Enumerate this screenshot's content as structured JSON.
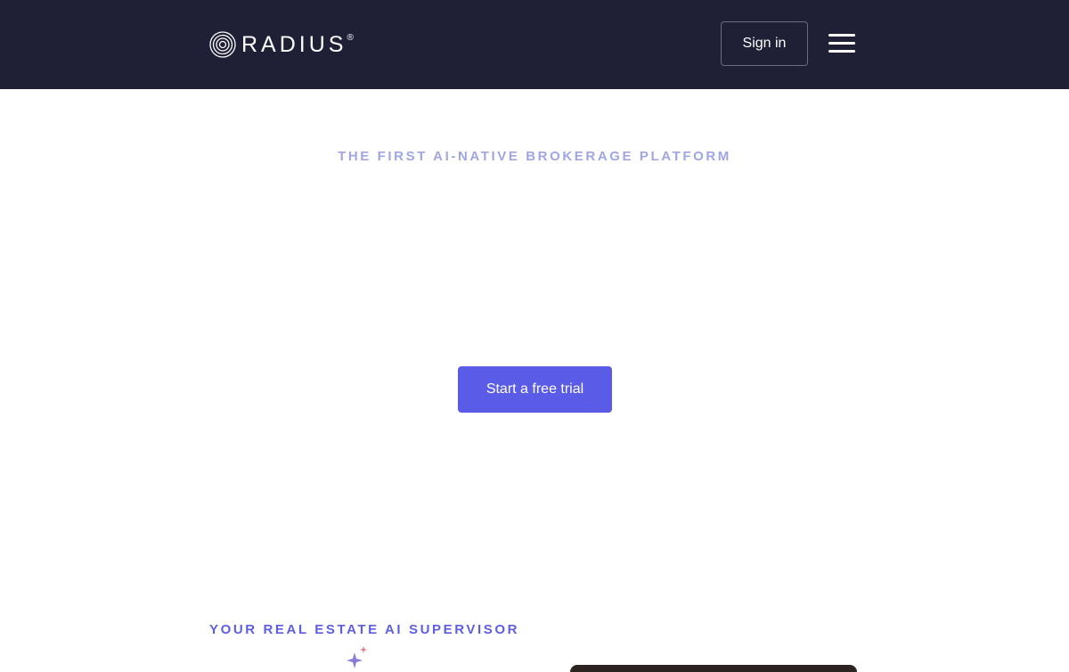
{
  "nav": {
    "logo_text": "RADIUS",
    "logo_reg": "®",
    "signin_label": "Sign in",
    "menu_icon": "hamburger-icon"
  },
  "hero": {
    "eyebrow": "THE FIRST AI-NATIVE BROKERAGE PLATFORM",
    "cta_label": "Start a free trial"
  },
  "section": {
    "eyebrow": "YOUR REAL ESTATE AI SUPERVISOR",
    "sparkle_icon": "sparkle-icon"
  },
  "colors": {
    "nav_bg": "#1f2036",
    "accent": "#5a5be6",
    "eyebrow_light": "#a0a6e4",
    "eyebrow_dark": "#5e5fe0"
  }
}
